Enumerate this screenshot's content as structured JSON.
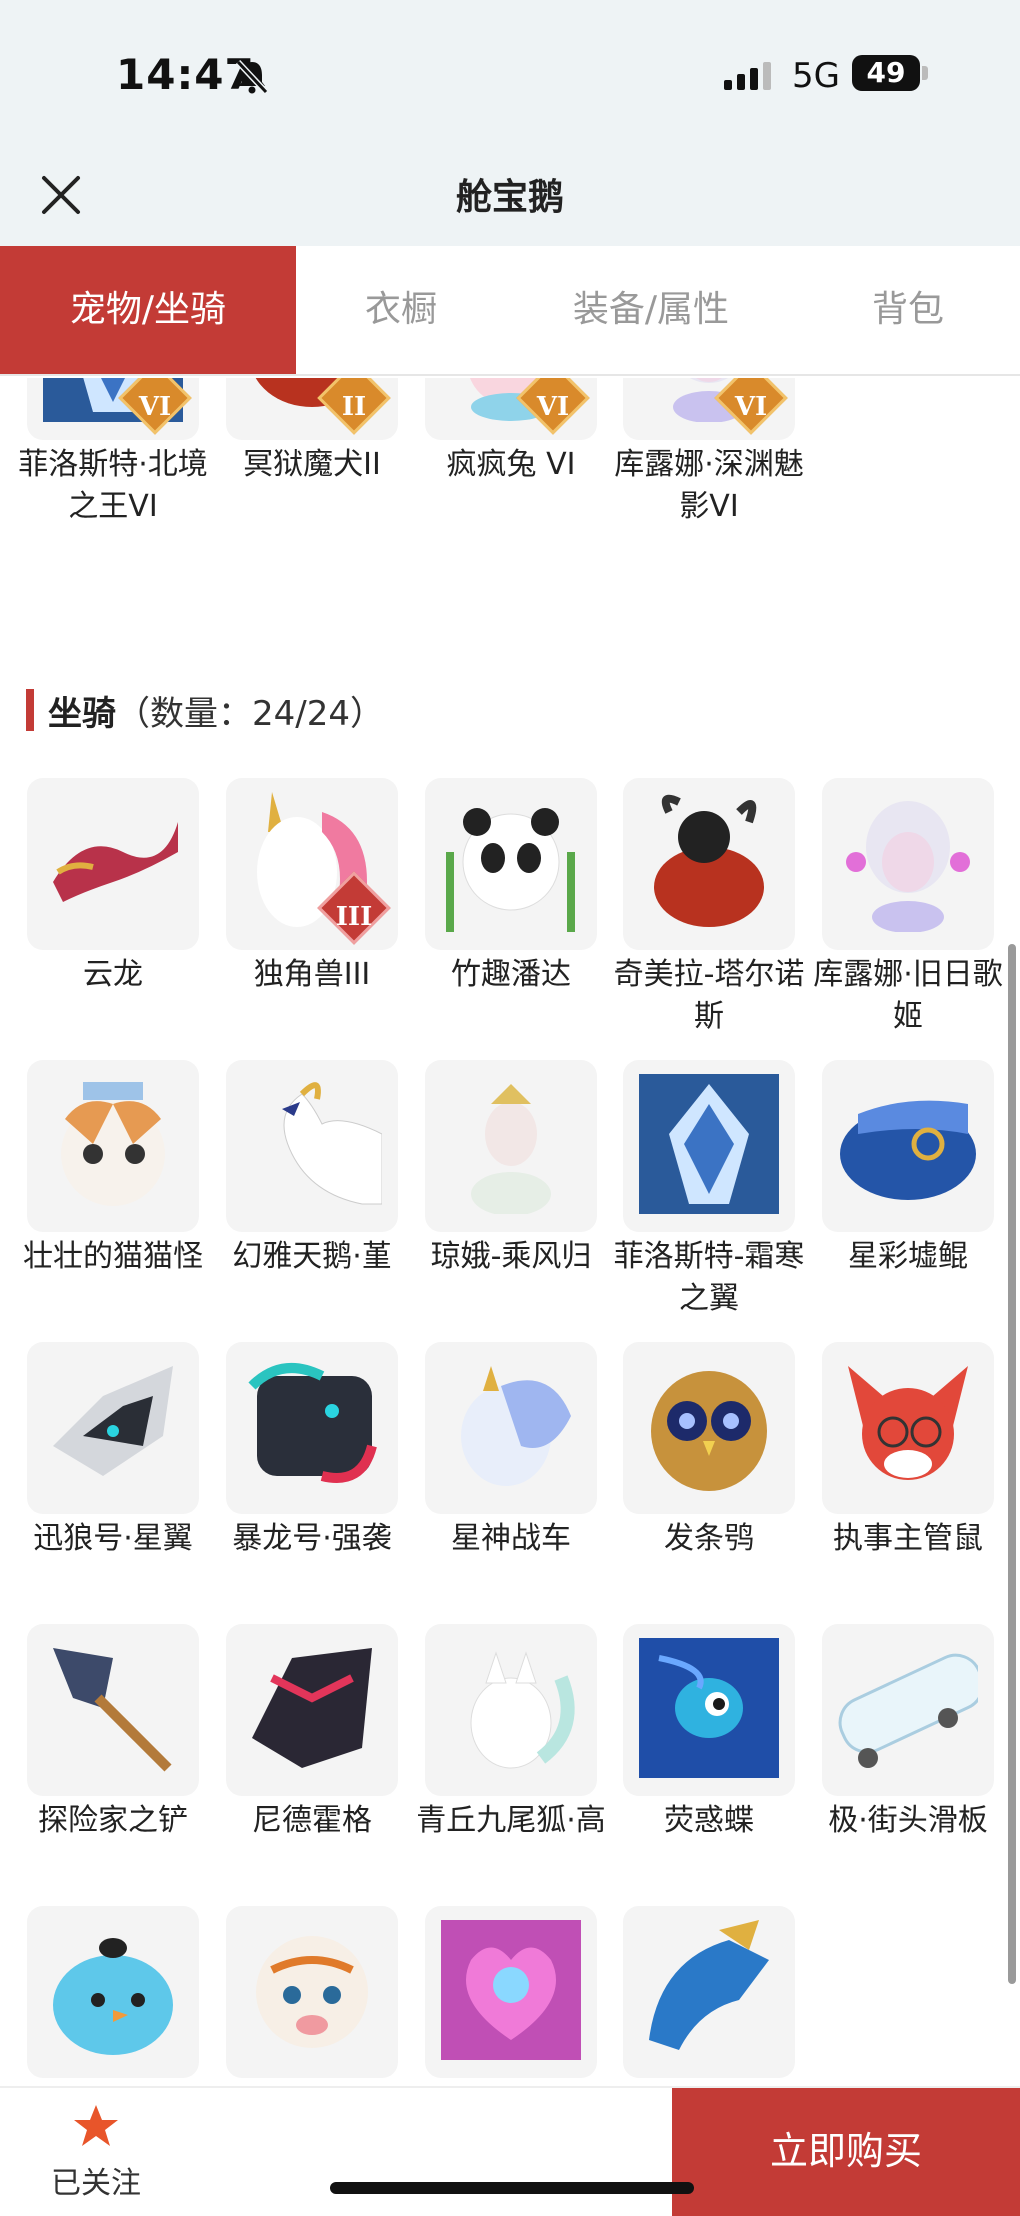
{
  "status_bar": {
    "time": "14:47",
    "network": "5G",
    "battery": "49"
  },
  "nav": {
    "title": "舱宝鹅"
  },
  "tabs": [
    {
      "label": "宠物/坐骑",
      "active": true
    },
    {
      "label": "衣橱",
      "active": false
    },
    {
      "label": "装备/属性",
      "active": false
    },
    {
      "label": "背包",
      "active": false
    }
  ],
  "pets": [
    {
      "name": "菲洛斯特·北境之王VI",
      "rank": "VI",
      "icon": "ice-knight"
    },
    {
      "name": "冥狱魔犬II",
      "rank": "II",
      "icon": "demon-dog"
    },
    {
      "name": "疯疯兔 VI",
      "rank": "VI",
      "icon": "bunny"
    },
    {
      "name": "库露娜·深渊魅影VI",
      "rank": "VI",
      "icon": "siren"
    }
  ],
  "mounts_section": {
    "title": "坐骑",
    "count": "（数量：24/24）"
  },
  "mounts": [
    {
      "name": "云龙",
      "icon": "cloud-dragon"
    },
    {
      "name": "独角兽III",
      "rank": "III",
      "icon": "unicorn"
    },
    {
      "name": "竹趣潘达",
      "icon": "panda"
    },
    {
      "name": "奇美拉-塔尔诺斯",
      "icon": "chimera"
    },
    {
      "name": "库露娜·旧日歌姬",
      "icon": "siren"
    },
    {
      "name": "壮壮的猫猫怪",
      "icon": "cat"
    },
    {
      "name": "幻雅天鹅·堇",
      "icon": "swan"
    },
    {
      "name": "琼娥-乘风归",
      "icon": "fairy"
    },
    {
      "name": "菲洛斯特-霜寒之翼",
      "icon": "ice-knight"
    },
    {
      "name": "星彩墟鲲",
      "icon": "whale"
    },
    {
      "name": "迅狼号·星翼",
      "icon": "mech-wolf"
    },
    {
      "name": "暴龙号·强袭",
      "icon": "mech-dino"
    },
    {
      "name": "星神战车",
      "icon": "star-horse"
    },
    {
      "name": "发条鸮",
      "icon": "owl"
    },
    {
      "name": "执事主管鼠",
      "icon": "butler-mouse"
    },
    {
      "name": "探险家之铲",
      "icon": "shovel"
    },
    {
      "name": "尼德霍格",
      "icon": "dark-dragon"
    },
    {
      "name": "青丘九尾狐·高",
      "icon": "fox"
    },
    {
      "name": "荧惑蝶",
      "icon": "butterfly"
    },
    {
      "name": "极·街头滑板",
      "icon": "skateboard"
    },
    {
      "name": "",
      "icon": "blue-bird"
    },
    {
      "name": "",
      "icon": "tiger"
    },
    {
      "name": "",
      "icon": "heart-gem"
    },
    {
      "name": "",
      "icon": "blue-dragon"
    }
  ],
  "bottom_bar": {
    "follow_label": "已关注",
    "buy_label": "立即购买"
  },
  "colors": {
    "accent": "#c33b36",
    "tab_inactive": "#999999",
    "thumb_bg": "#f4f4f4",
    "rank_gold": "#d98a2b"
  }
}
